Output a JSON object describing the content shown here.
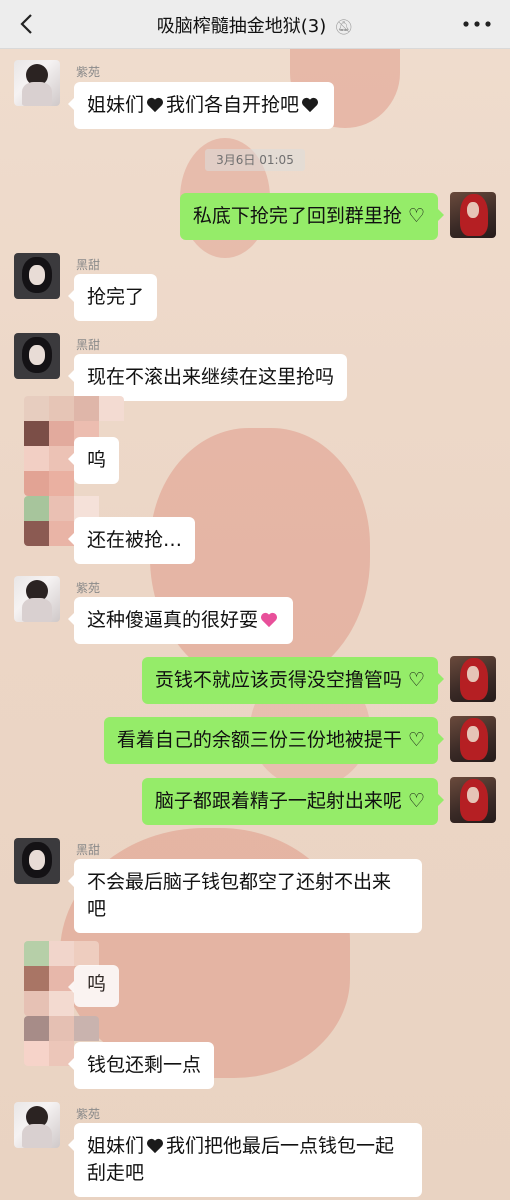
{
  "header": {
    "title": "吸脑榨髓抽金地狱(3)",
    "back_icon": "chevron-left-icon",
    "mute_icon": "muted-bell-icon",
    "more_icon": "more-dots-icon"
  },
  "timestamp": "3月6日 01:05",
  "messages": [
    {
      "sender": "紫苑",
      "text_a": "姐妹们",
      "text_b": "我们各自开抢吧",
      "emoji": "black-heart"
    },
    {
      "sender": "",
      "text": "私底下抢完了回到群里抢 ♡"
    },
    {
      "sender": "黑甜",
      "text": "抢完了"
    },
    {
      "sender": "黑甜",
      "text": "现在不滚出来继续在这里抢吗"
    },
    {
      "sender": "",
      "text": "呜"
    },
    {
      "sender": "",
      "text": "还在被抢…"
    },
    {
      "sender": "紫苑",
      "text": "这种傻逼真的很好耍",
      "emoji": "pink-heart"
    },
    {
      "sender": "",
      "text": "贡钱不就应该贡得没空撸管吗 ♡"
    },
    {
      "sender": "",
      "text": "看着自己的余额三份三份地被提干 ♡"
    },
    {
      "sender": "",
      "text": "脑子都跟着精子一起射出来呢 ♡"
    },
    {
      "sender": "黑甜",
      "text_a": "不会最后脑子钱包都空了还射不出来",
      "text_b": "吧"
    },
    {
      "sender": "",
      "text": "呜"
    },
    {
      "sender": "",
      "text": "钱包还剩一点"
    },
    {
      "sender": "紫苑",
      "text_a": "姐妹们",
      "text_b": "我们把他最后一点钱包一起",
      "text_c": "刮走吧",
      "emoji": "black-heart"
    }
  ],
  "colors": {
    "self_bubble": "#95ec69",
    "other_bubble": "#ffffff",
    "header_bg": "#ededed"
  }
}
